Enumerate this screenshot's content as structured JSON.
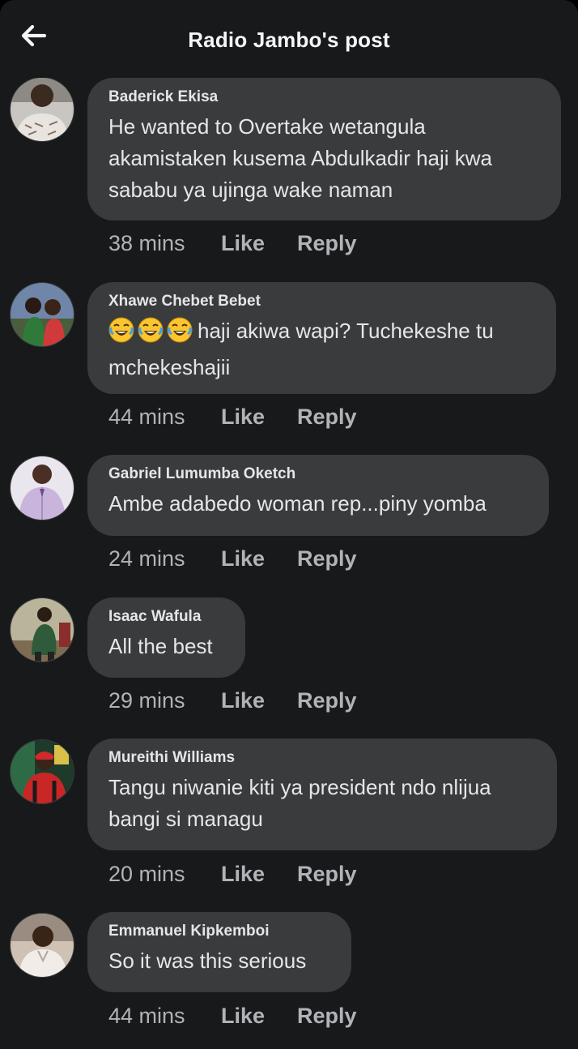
{
  "header": {
    "title": "Radio Jambo's post",
    "back_icon": "arrow-left-icon"
  },
  "comments": [
    {
      "author": "Baderick Ekisa",
      "text": "He wanted to Overtake wetangula akamistaken kusema Abdulkadir haji kwa sababu ya ujinga wake naman",
      "time": "38 mins",
      "like": "Like",
      "reply": "Reply"
    },
    {
      "author": "Xhawe Chebet Bebet",
      "emojis": [
        "😂",
        "😂",
        "😂"
      ],
      "text": "haji akiwa wapi? Tuchekeshe tu mchekeshajii",
      "time": "44 mins",
      "like": "Like",
      "reply": "Reply"
    },
    {
      "author": "Gabriel Lumumba Oketch",
      "text": "Ambe adabedo woman rep...piny yomba",
      "time": "24 mins",
      "like": "Like",
      "reply": "Reply"
    },
    {
      "author": "Isaac Wafula",
      "text": "All the best",
      "time": "29 mins",
      "like": "Like",
      "reply": "Reply"
    },
    {
      "author": "Mureithi Williams",
      "text": "Tangu niwanie kiti ya president ndo nlijua bangi si managu",
      "time": "20 mins",
      "like": "Like",
      "reply": "Reply"
    },
    {
      "author": "Emmanuel Kipkemboi",
      "text": "So it was this serious",
      "time": "44 mins",
      "like": "Like",
      "reply": "Reply"
    }
  ],
  "colors": {
    "background": "#18191a",
    "bubble": "#3a3b3c",
    "text": "#e4e6eb",
    "secondary": "#b0b3b8"
  }
}
